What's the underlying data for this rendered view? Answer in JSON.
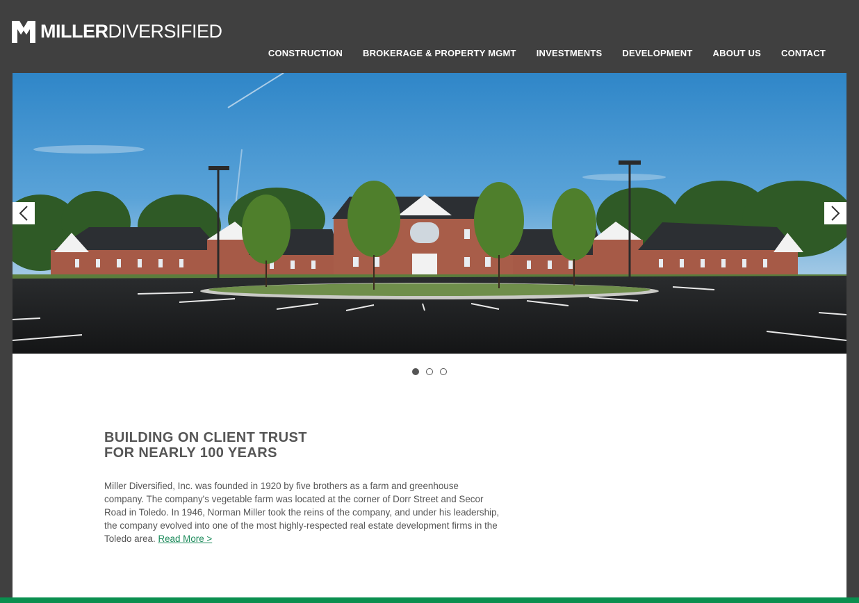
{
  "logo": {
    "brand_bold": "MILLER",
    "brand_light": "DIVERSIFIED"
  },
  "nav": {
    "items": [
      "CONSTRUCTION",
      "BROKERAGE & PROPERTY MGMT",
      "INVESTMENTS",
      "DEVELOPMENT",
      "ABOUT US",
      "CONTACT"
    ]
  },
  "slider": {
    "prev_icon": "chevron-left-icon",
    "next_icon": "chevron-right-icon",
    "dot_count": 3,
    "active_dot": 1
  },
  "main": {
    "headline_line1": "BUILDING ON CLIENT TRUST",
    "headline_line2": "FOR NEARLY 100 YEARS",
    "body": "Miller Diversified, Inc. was founded in 1920 by five brothers as a farm and greenhouse company. The company's vegetable farm was located at the corner of Dorr Street and Secor Road in Toledo. In 1946, Norman Miller took the reins of the company, and under his leadership, the company evolved into one of the most highly-respected real estate development firms in the Toledo area.",
    "read_more": "Read More >"
  },
  "colors": {
    "background": "#404040",
    "accent_green": "#0a8f4f",
    "link_green": "#1b8a5a",
    "text": "#555555"
  }
}
